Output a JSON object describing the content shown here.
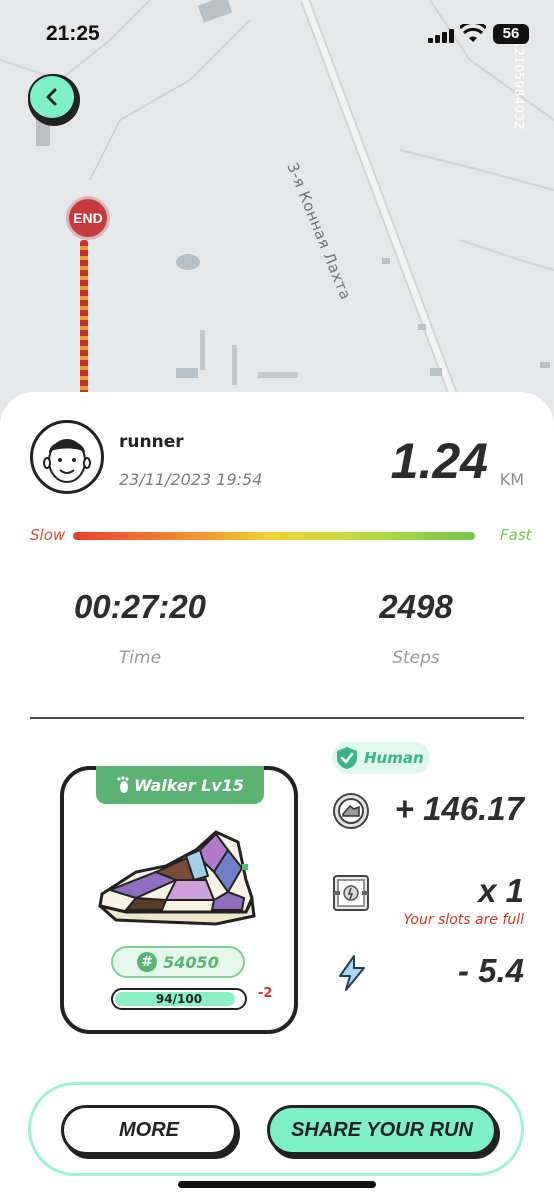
{
  "status_bar": {
    "time": "21:25",
    "battery": "56"
  },
  "map": {
    "street_name": "3-я Конная Лахта",
    "watermark": "1210598403Z",
    "end_marker": "END"
  },
  "runner": {
    "name": "runner",
    "date": "23/11/2023 19:54"
  },
  "distance": {
    "value": "1.24",
    "unit": "KM"
  },
  "pace": {
    "slow_label": "Slow",
    "fast_label": "Fast"
  },
  "stats": {
    "time_value": "00:27:20",
    "time_label": "Time",
    "steps_value": "2498",
    "steps_label": "Steps"
  },
  "sneaker": {
    "tag": "Walker Lv15",
    "id": "54050",
    "durability_text": "94/100",
    "durability_fraction": 0.94,
    "durability_change": "-2"
  },
  "rewards": {
    "human_label": "Human",
    "coin_value": "+ 146.17",
    "box_value": "x 1",
    "slots_note": "Your slots are full",
    "energy_value": "- 5.4"
  },
  "actions": {
    "more_label": "MORE",
    "share_label": "SHARE YOUR RUN"
  },
  "colors": {
    "accent": "#7df0c7",
    "tag_green": "#5ab273",
    "warning_red": "#d0342c"
  }
}
